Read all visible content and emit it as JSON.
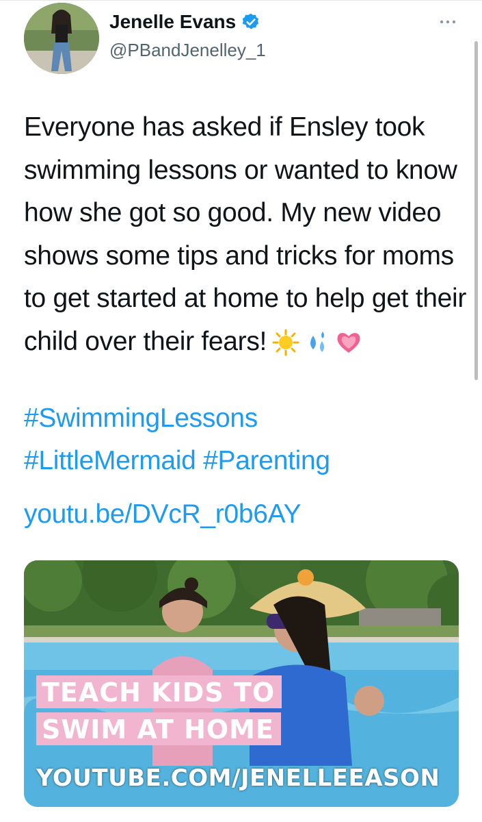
{
  "author": {
    "name": "Jenelle Evans",
    "handle": "@PBandJenelley_1",
    "verified": true,
    "avatar_icon": "profile-photo"
  },
  "tweet": {
    "text": "Everyone has asked if Ensley took swimming lessons or wanted to know how she got so good. My new video shows some tips and tricks for moms to get started at home to help get their child over their fears!",
    "emojis": [
      "sun-icon",
      "sweat-droplets-icon",
      "growing-heart-icon"
    ],
    "hashtags": [
      "#SwimmingLessons",
      "#LittleMermaid",
      "#Parenting"
    ],
    "link": "youtu.be/DVcR_r0b6AY"
  },
  "media": {
    "overlay_line1": "TEACH KIDS TO",
    "overlay_line2": "SWIM AT HOME",
    "overlay_url": "YOUTUBE.COM/JENELLEEASON"
  },
  "colors": {
    "link": "#1d9bf0",
    "verified_badge": "#1d9bf0",
    "overlay_pink": "#f2b5cf",
    "handle_gray": "#536471"
  }
}
